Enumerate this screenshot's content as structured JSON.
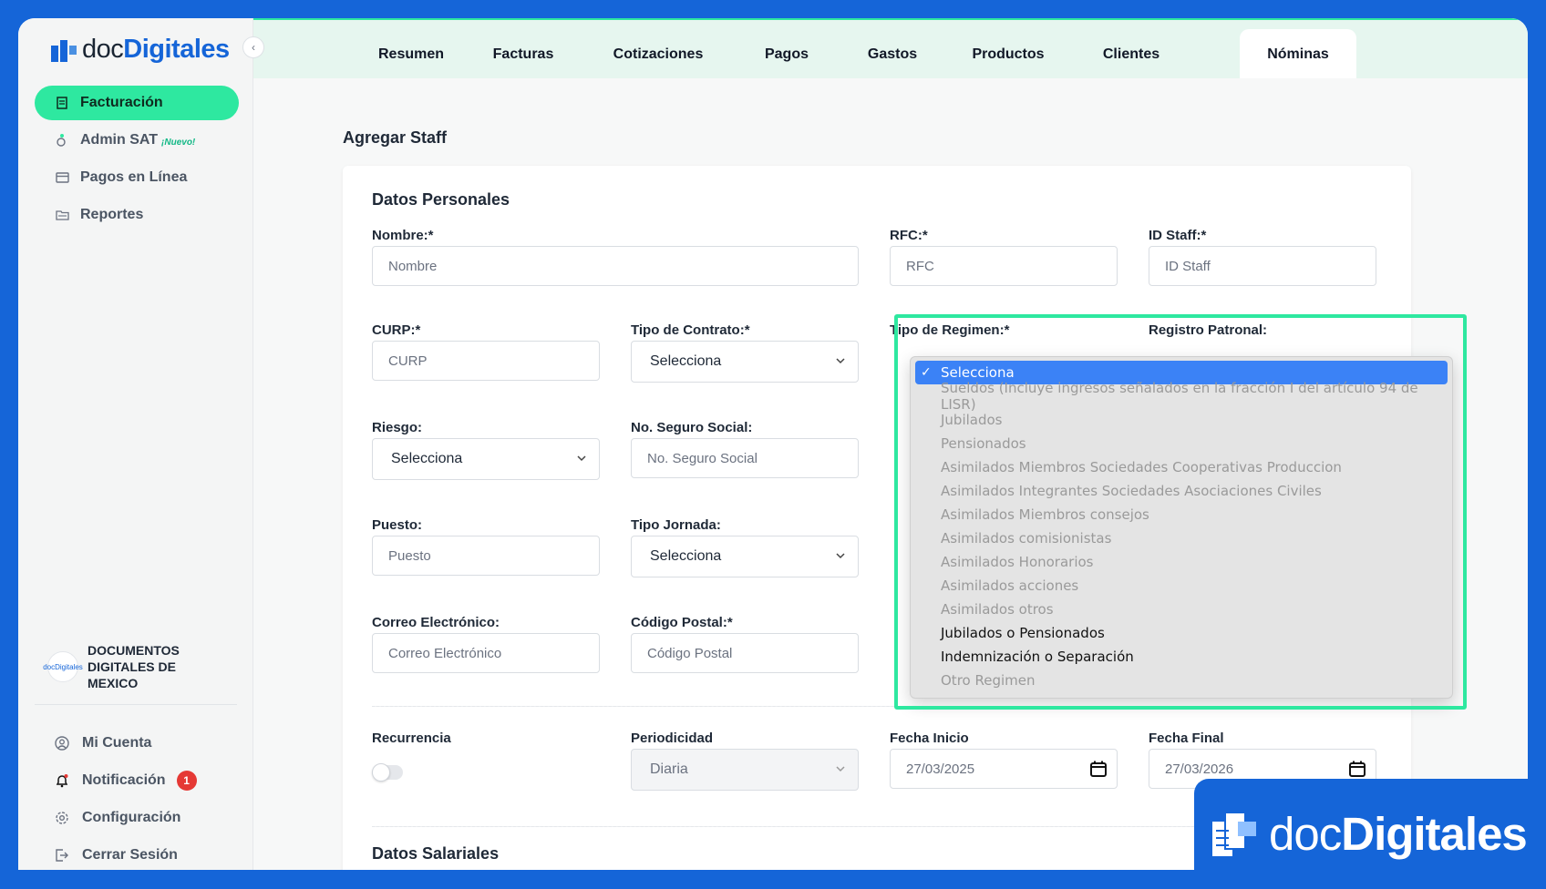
{
  "brand": {
    "prefix": "doc",
    "suffix": "Digitales",
    "color": "#1565d8",
    "accent": "#2ee8a0"
  },
  "sidebar": {
    "items": [
      {
        "label": "Facturación",
        "icon": "receipt-icon",
        "active": true
      },
      {
        "label": "Admin SAT",
        "icon": "admin-sat-icon",
        "tag": "¡Nuevo!"
      },
      {
        "label": "Pagos en Línea",
        "icon": "card-icon"
      },
      {
        "label": "Reportes",
        "icon": "folder-icon"
      }
    ],
    "company": "DOCUMENTOS DIGITALES DE MEXICO",
    "company_avatar": "docDigitales",
    "bottom": [
      {
        "label": "Mi Cuenta",
        "icon": "user-circle-icon"
      },
      {
        "label": "Notificación",
        "icon": "bell-icon",
        "badge": "1"
      },
      {
        "label": "Configuración",
        "icon": "gear-icon"
      },
      {
        "label": "Cerrar Sesión",
        "icon": "logout-icon"
      }
    ]
  },
  "tabs": [
    "Resumen",
    "Facturas",
    "Cotizaciones",
    "Pagos",
    "Gastos",
    "Productos",
    "Clientes",
    "Nóminas"
  ],
  "active_tab": "Nóminas",
  "page_title": "Agregar Staff",
  "form": {
    "personal_title": "Datos Personales",
    "nombre": {
      "label": "Nombre:*",
      "placeholder": "Nombre"
    },
    "rfc": {
      "label": "RFC:*",
      "placeholder": "RFC"
    },
    "id_staff": {
      "label": "ID Staff:*",
      "placeholder": "ID Staff"
    },
    "curp": {
      "label": "CURP:*",
      "placeholder": "CURP"
    },
    "tipo_contrato": {
      "label": "Tipo de Contrato:*",
      "value": "Selecciona"
    },
    "tipo_regimen": {
      "label": "Tipo de Regimen:*"
    },
    "registro_patronal": {
      "label": "Registro Patronal:"
    },
    "riesgo": {
      "label": "Riesgo:",
      "value": "Selecciona"
    },
    "nss": {
      "label": "No. Seguro Social:",
      "placeholder": "No. Seguro Social"
    },
    "puesto": {
      "label": "Puesto:",
      "placeholder": "Puesto"
    },
    "tipo_jornada": {
      "label": "Tipo Jornada:",
      "value": "Selecciona"
    },
    "correo": {
      "label": "Correo Electrónico:",
      "placeholder": "Correo Electrónico"
    },
    "codigo_postal": {
      "label": "Código Postal:*",
      "placeholder": "Código Postal"
    },
    "recurrencia": {
      "label": "Recurrencia",
      "on": false
    },
    "periodicidad": {
      "label": "Periodicidad",
      "value": "Diaria"
    },
    "fecha_inicio": {
      "label": "Fecha Inicio",
      "value": "27/03/2025"
    },
    "fecha_final": {
      "label": "Fecha Final",
      "value": "27/03/2026"
    },
    "salary_title": "Datos Salariales"
  },
  "regimen_options": [
    {
      "label": "Selecciona",
      "state": "selected"
    },
    {
      "label": "Sueldos (Incluye ingresos señalados en la fracción I del artículo 94 de LISR)",
      "state": "disabled"
    },
    {
      "label": "Jubilados",
      "state": "disabled"
    },
    {
      "label": "Pensionados",
      "state": "disabled"
    },
    {
      "label": "Asimilados Miembros Sociedades Cooperativas Produccion",
      "state": "disabled"
    },
    {
      "label": "Asimilados Integrantes Sociedades Asociaciones Civiles",
      "state": "disabled"
    },
    {
      "label": "Asimilados Miembros consejos",
      "state": "disabled"
    },
    {
      "label": "Asimilados comisionistas",
      "state": "disabled"
    },
    {
      "label": "Asimilados Honorarios",
      "state": "disabled"
    },
    {
      "label": "Asimilados acciones",
      "state": "disabled"
    },
    {
      "label": "Asimilados otros",
      "state": "disabled"
    },
    {
      "label": "Jubilados o Pensionados",
      "state": "enabled"
    },
    {
      "label": "Indemnización o Separación",
      "state": "enabled"
    },
    {
      "label": "Otro Regimen",
      "state": "disabled"
    }
  ]
}
